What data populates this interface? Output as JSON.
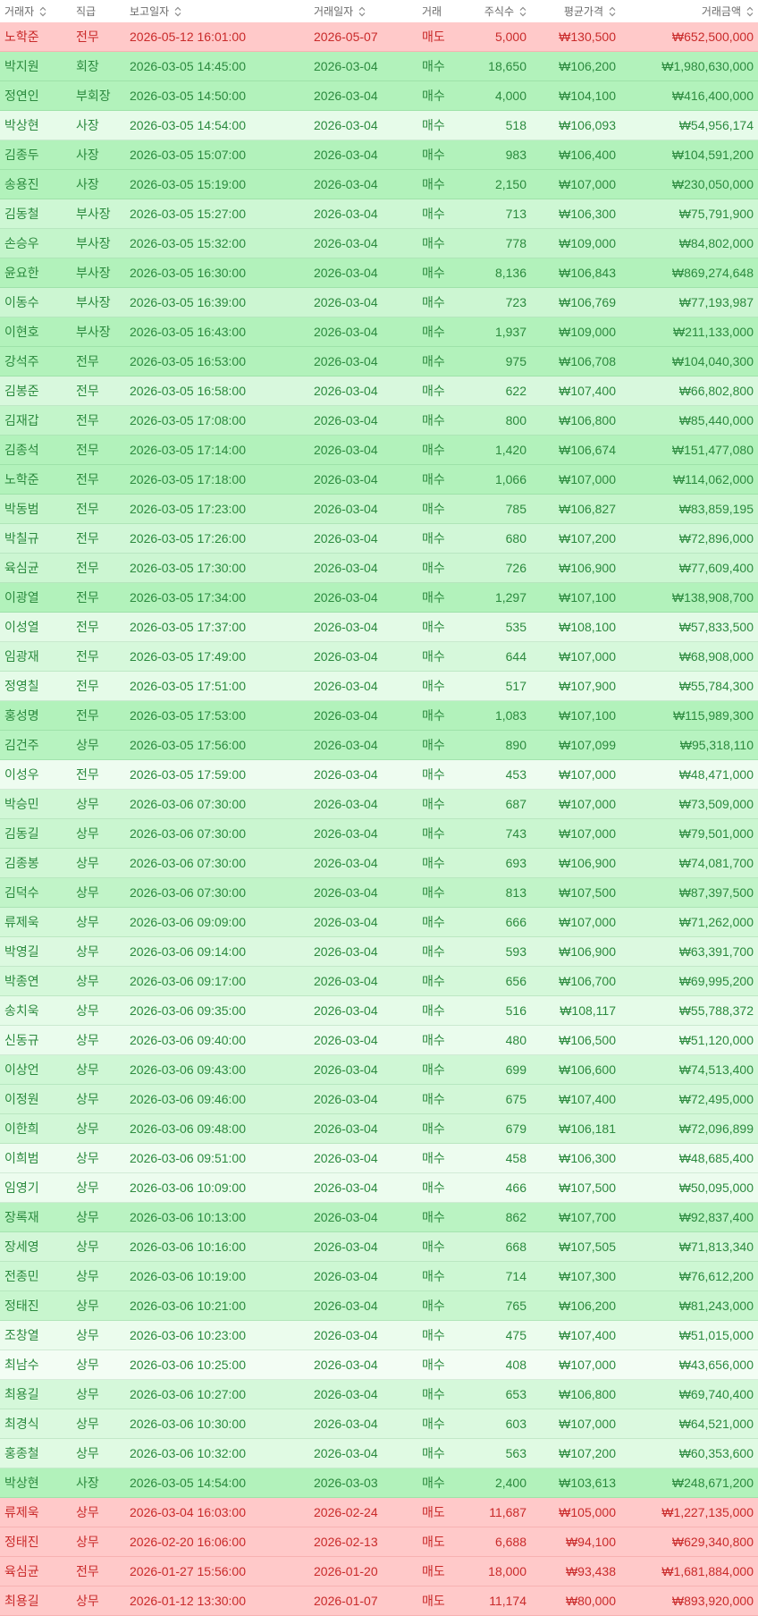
{
  "colors": {
    "header_text": "#6b6b6b",
    "sort_icon": "#8a8a8a",
    "buy_text": "#2b8a3e",
    "sell_text": "#c92a2a",
    "buy_bg": "#b2f2bb",
    "sell_bg": "#ffc9c9"
  },
  "table": {
    "columns": [
      {
        "label": "거래자",
        "icon": "sort-icon"
      },
      {
        "label": "직급"
      },
      {
        "label": "보고일자",
        "icon": "sort-icon"
      },
      {
        "label": "거래일자",
        "icon": "sort-icon"
      },
      {
        "label": "거래"
      },
      {
        "label": "주식수",
        "icon": "sort-icon"
      },
      {
        "label": "평균가격",
        "icon": "sort-icon"
      },
      {
        "label": "거래금액",
        "icon": "sort-icon"
      }
    ],
    "rows": [
      {
        "trader": "노학준",
        "position": "전무",
        "reported_at": "2026-05-12 16:01:00",
        "traded_on": "2026-05-07",
        "type": "매도",
        "shares": "5,000",
        "avg_price": "₩130,500",
        "amount": "₩652,500,000"
      },
      {
        "trader": "박지원",
        "position": "회장",
        "reported_at": "2026-03-05 14:45:00",
        "traded_on": "2026-03-04",
        "type": "매수",
        "shares": "18,650",
        "avg_price": "₩106,200",
        "amount": "₩1,980,630,000"
      },
      {
        "trader": "정연인",
        "position": "부회장",
        "reported_at": "2026-03-05 14:50:00",
        "traded_on": "2026-03-04",
        "type": "매수",
        "shares": "4,000",
        "avg_price": "₩104,100",
        "amount": "₩416,400,000"
      },
      {
        "trader": "박상현",
        "position": "사장",
        "reported_at": "2026-03-05 14:54:00",
        "traded_on": "2026-03-04",
        "type": "매수",
        "shares": "518",
        "avg_price": "₩106,093",
        "amount": "₩54,956,174"
      },
      {
        "trader": "김종두",
        "position": "사장",
        "reported_at": "2026-03-05 15:07:00",
        "traded_on": "2026-03-04",
        "type": "매수",
        "shares": "983",
        "avg_price": "₩106,400",
        "amount": "₩104,591,200"
      },
      {
        "trader": "송용진",
        "position": "사장",
        "reported_at": "2026-03-05 15:19:00",
        "traded_on": "2026-03-04",
        "type": "매수",
        "shares": "2,150",
        "avg_price": "₩107,000",
        "amount": "₩230,050,000"
      },
      {
        "trader": "김동철",
        "position": "부사장",
        "reported_at": "2026-03-05 15:27:00",
        "traded_on": "2026-03-04",
        "type": "매수",
        "shares": "713",
        "avg_price": "₩106,300",
        "amount": "₩75,791,900"
      },
      {
        "trader": "손승우",
        "position": "부사장",
        "reported_at": "2026-03-05 15:32:00",
        "traded_on": "2026-03-04",
        "type": "매수",
        "shares": "778",
        "avg_price": "₩109,000",
        "amount": "₩84,802,000"
      },
      {
        "trader": "윤요한",
        "position": "부사장",
        "reported_at": "2026-03-05 16:30:00",
        "traded_on": "2026-03-04",
        "type": "매수",
        "shares": "8,136",
        "avg_price": "₩106,843",
        "amount": "₩869,274,648"
      },
      {
        "trader": "이동수",
        "position": "부사장",
        "reported_at": "2026-03-05 16:39:00",
        "traded_on": "2026-03-04",
        "type": "매수",
        "shares": "723",
        "avg_price": "₩106,769",
        "amount": "₩77,193,987"
      },
      {
        "trader": "이현호",
        "position": "부사장",
        "reported_at": "2026-03-05 16:43:00",
        "traded_on": "2026-03-04",
        "type": "매수",
        "shares": "1,937",
        "avg_price": "₩109,000",
        "amount": "₩211,133,000"
      },
      {
        "trader": "강석주",
        "position": "전무",
        "reported_at": "2026-03-05 16:53:00",
        "traded_on": "2026-03-04",
        "type": "매수",
        "shares": "975",
        "avg_price": "₩106,708",
        "amount": "₩104,040,300"
      },
      {
        "trader": "김봉준",
        "position": "전무",
        "reported_at": "2026-03-05 16:58:00",
        "traded_on": "2026-03-04",
        "type": "매수",
        "shares": "622",
        "avg_price": "₩107,400",
        "amount": "₩66,802,800"
      },
      {
        "trader": "김재갑",
        "position": "전무",
        "reported_at": "2026-03-05 17:08:00",
        "traded_on": "2026-03-04",
        "type": "매수",
        "shares": "800",
        "avg_price": "₩106,800",
        "amount": "₩85,440,000"
      },
      {
        "trader": "김종석",
        "position": "전무",
        "reported_at": "2026-03-05 17:14:00",
        "traded_on": "2026-03-04",
        "type": "매수",
        "shares": "1,420",
        "avg_price": "₩106,674",
        "amount": "₩151,477,080"
      },
      {
        "trader": "노학준",
        "position": "전무",
        "reported_at": "2026-03-05 17:18:00",
        "traded_on": "2026-03-04",
        "type": "매수",
        "shares": "1,066",
        "avg_price": "₩107,000",
        "amount": "₩114,062,000"
      },
      {
        "trader": "박동범",
        "position": "전무",
        "reported_at": "2026-03-05 17:23:00",
        "traded_on": "2026-03-04",
        "type": "매수",
        "shares": "785",
        "avg_price": "₩106,827",
        "amount": "₩83,859,195"
      },
      {
        "trader": "박칠규",
        "position": "전무",
        "reported_at": "2026-03-05 17:26:00",
        "traded_on": "2026-03-04",
        "type": "매수",
        "shares": "680",
        "avg_price": "₩107,200",
        "amount": "₩72,896,000"
      },
      {
        "trader": "육심균",
        "position": "전무",
        "reported_at": "2026-03-05 17:30:00",
        "traded_on": "2026-03-04",
        "type": "매수",
        "shares": "726",
        "avg_price": "₩106,900",
        "amount": "₩77,609,400"
      },
      {
        "trader": "이광열",
        "position": "전무",
        "reported_at": "2026-03-05 17:34:00",
        "traded_on": "2026-03-04",
        "type": "매수",
        "shares": "1,297",
        "avg_price": "₩107,100",
        "amount": "₩138,908,700"
      },
      {
        "trader": "이성열",
        "position": "전무",
        "reported_at": "2026-03-05 17:37:00",
        "traded_on": "2026-03-04",
        "type": "매수",
        "shares": "535",
        "avg_price": "₩108,100",
        "amount": "₩57,833,500"
      },
      {
        "trader": "임광재",
        "position": "전무",
        "reported_at": "2026-03-05 17:49:00",
        "traded_on": "2026-03-04",
        "type": "매수",
        "shares": "644",
        "avg_price": "₩107,000",
        "amount": "₩68,908,000"
      },
      {
        "trader": "정영칠",
        "position": "전무",
        "reported_at": "2026-03-05 17:51:00",
        "traded_on": "2026-03-04",
        "type": "매수",
        "shares": "517",
        "avg_price": "₩107,900",
        "amount": "₩55,784,300"
      },
      {
        "trader": "홍성명",
        "position": "전무",
        "reported_at": "2026-03-05 17:53:00",
        "traded_on": "2026-03-04",
        "type": "매수",
        "shares": "1,083",
        "avg_price": "₩107,100",
        "amount": "₩115,989,300"
      },
      {
        "trader": "김건주",
        "position": "상무",
        "reported_at": "2026-03-05 17:56:00",
        "traded_on": "2026-03-04",
        "type": "매수",
        "shares": "890",
        "avg_price": "₩107,099",
        "amount": "₩95,318,110"
      },
      {
        "trader": "이성우",
        "position": "전무",
        "reported_at": "2026-03-05 17:59:00",
        "traded_on": "2026-03-04",
        "type": "매수",
        "shares": "453",
        "avg_price": "₩107,000",
        "amount": "₩48,471,000"
      },
      {
        "trader": "박승민",
        "position": "상무",
        "reported_at": "2026-03-06 07:30:00",
        "traded_on": "2026-03-04",
        "type": "매수",
        "shares": "687",
        "avg_price": "₩107,000",
        "amount": "₩73,509,000"
      },
      {
        "trader": "김동길",
        "position": "상무",
        "reported_at": "2026-03-06 07:30:00",
        "traded_on": "2026-03-04",
        "type": "매수",
        "shares": "743",
        "avg_price": "₩107,000",
        "amount": "₩79,501,000"
      },
      {
        "trader": "김종봉",
        "position": "상무",
        "reported_at": "2026-03-06 07:30:00",
        "traded_on": "2026-03-04",
        "type": "매수",
        "shares": "693",
        "avg_price": "₩106,900",
        "amount": "₩74,081,700"
      },
      {
        "trader": "김덕수",
        "position": "상무",
        "reported_at": "2026-03-06 07:30:00",
        "traded_on": "2026-03-04",
        "type": "매수",
        "shares": "813",
        "avg_price": "₩107,500",
        "amount": "₩87,397,500"
      },
      {
        "trader": "류제욱",
        "position": "상무",
        "reported_at": "2026-03-06 09:09:00",
        "traded_on": "2026-03-04",
        "type": "매수",
        "shares": "666",
        "avg_price": "₩107,000",
        "amount": "₩71,262,000"
      },
      {
        "trader": "박영길",
        "position": "상무",
        "reported_at": "2026-03-06 09:14:00",
        "traded_on": "2026-03-04",
        "type": "매수",
        "shares": "593",
        "avg_price": "₩106,900",
        "amount": "₩63,391,700"
      },
      {
        "trader": "박종연",
        "position": "상무",
        "reported_at": "2026-03-06 09:17:00",
        "traded_on": "2026-03-04",
        "type": "매수",
        "shares": "656",
        "avg_price": "₩106,700",
        "amount": "₩69,995,200"
      },
      {
        "trader": "송치욱",
        "position": "상무",
        "reported_at": "2026-03-06 09:35:00",
        "traded_on": "2026-03-04",
        "type": "매수",
        "shares": "516",
        "avg_price": "₩108,117",
        "amount": "₩55,788,372"
      },
      {
        "trader": "신동규",
        "position": "상무",
        "reported_at": "2026-03-06 09:40:00",
        "traded_on": "2026-03-04",
        "type": "매수",
        "shares": "480",
        "avg_price": "₩106,500",
        "amount": "₩51,120,000"
      },
      {
        "trader": "이상언",
        "position": "상무",
        "reported_at": "2026-03-06 09:43:00",
        "traded_on": "2026-03-04",
        "type": "매수",
        "shares": "699",
        "avg_price": "₩106,600",
        "amount": "₩74,513,400"
      },
      {
        "trader": "이정원",
        "position": "상무",
        "reported_at": "2026-03-06 09:46:00",
        "traded_on": "2026-03-04",
        "type": "매수",
        "shares": "675",
        "avg_price": "₩107,400",
        "amount": "₩72,495,000"
      },
      {
        "trader": "이한희",
        "position": "상무",
        "reported_at": "2026-03-06 09:48:00",
        "traded_on": "2026-03-04",
        "type": "매수",
        "shares": "679",
        "avg_price": "₩106,181",
        "amount": "₩72,096,899"
      },
      {
        "trader": "이희범",
        "position": "상무",
        "reported_at": "2026-03-06 09:51:00",
        "traded_on": "2026-03-04",
        "type": "매수",
        "shares": "458",
        "avg_price": "₩106,300",
        "amount": "₩48,685,400"
      },
      {
        "trader": "임영기",
        "position": "상무",
        "reported_at": "2026-03-06 10:09:00",
        "traded_on": "2026-03-04",
        "type": "매수",
        "shares": "466",
        "avg_price": "₩107,500",
        "amount": "₩50,095,000"
      },
      {
        "trader": "장록재",
        "position": "상무",
        "reported_at": "2026-03-06 10:13:00",
        "traded_on": "2026-03-04",
        "type": "매수",
        "shares": "862",
        "avg_price": "₩107,700",
        "amount": "₩92,837,400"
      },
      {
        "trader": "장세영",
        "position": "상무",
        "reported_at": "2026-03-06 10:16:00",
        "traded_on": "2026-03-04",
        "type": "매수",
        "shares": "668",
        "avg_price": "₩107,505",
        "amount": "₩71,813,340"
      },
      {
        "trader": "전종민",
        "position": "상무",
        "reported_at": "2026-03-06 10:19:00",
        "traded_on": "2026-03-04",
        "type": "매수",
        "shares": "714",
        "avg_price": "₩107,300",
        "amount": "₩76,612,200"
      },
      {
        "trader": "정태진",
        "position": "상무",
        "reported_at": "2026-03-06 10:21:00",
        "traded_on": "2026-03-04",
        "type": "매수",
        "shares": "765",
        "avg_price": "₩106,200",
        "amount": "₩81,243,000"
      },
      {
        "trader": "조창열",
        "position": "상무",
        "reported_at": "2026-03-06 10:23:00",
        "traded_on": "2026-03-04",
        "type": "매수",
        "shares": "475",
        "avg_price": "₩107,400",
        "amount": "₩51,015,000"
      },
      {
        "trader": "최남수",
        "position": "상무",
        "reported_at": "2026-03-06 10:25:00",
        "traded_on": "2026-03-04",
        "type": "매수",
        "shares": "408",
        "avg_price": "₩107,000",
        "amount": "₩43,656,000"
      },
      {
        "trader": "최용길",
        "position": "상무",
        "reported_at": "2026-03-06 10:27:00",
        "traded_on": "2026-03-04",
        "type": "매수",
        "shares": "653",
        "avg_price": "₩106,800",
        "amount": "₩69,740,400"
      },
      {
        "trader": "최경식",
        "position": "상무",
        "reported_at": "2026-03-06 10:30:00",
        "traded_on": "2026-03-04",
        "type": "매수",
        "shares": "603",
        "avg_price": "₩107,000",
        "amount": "₩64,521,000"
      },
      {
        "trader": "홍종철",
        "position": "상무",
        "reported_at": "2026-03-06 10:32:00",
        "traded_on": "2026-03-04",
        "type": "매수",
        "shares": "563",
        "avg_price": "₩107,200",
        "amount": "₩60,353,600"
      },
      {
        "trader": "박상현",
        "position": "사장",
        "reported_at": "2026-03-05 14:54:00",
        "traded_on": "2026-03-03",
        "type": "매수",
        "shares": "2,400",
        "avg_price": "₩103,613",
        "amount": "₩248,671,200"
      },
      {
        "trader": "류제욱",
        "position": "상무",
        "reported_at": "2026-03-04 16:03:00",
        "traded_on": "2026-02-24",
        "type": "매도",
        "shares": "11,687",
        "avg_price": "₩105,000",
        "amount": "₩1,227,135,000"
      },
      {
        "trader": "정태진",
        "position": "상무",
        "reported_at": "2026-02-20 16:06:00",
        "traded_on": "2026-02-13",
        "type": "매도",
        "shares": "6,688",
        "avg_price": "₩94,100",
        "amount": "₩629,340,800"
      },
      {
        "trader": "육심균",
        "position": "전무",
        "reported_at": "2026-01-27 15:56:00",
        "traded_on": "2026-01-20",
        "type": "매도",
        "shares": "18,000",
        "avg_price": "₩93,438",
        "amount": "₩1,681,884,000"
      },
      {
        "trader": "최용길",
        "position": "상무",
        "reported_at": "2026-01-12 13:30:00",
        "traded_on": "2026-01-07",
        "type": "매도",
        "shares": "11,174",
        "avg_price": "₩80,000",
        "amount": "₩893,920,000"
      }
    ]
  }
}
